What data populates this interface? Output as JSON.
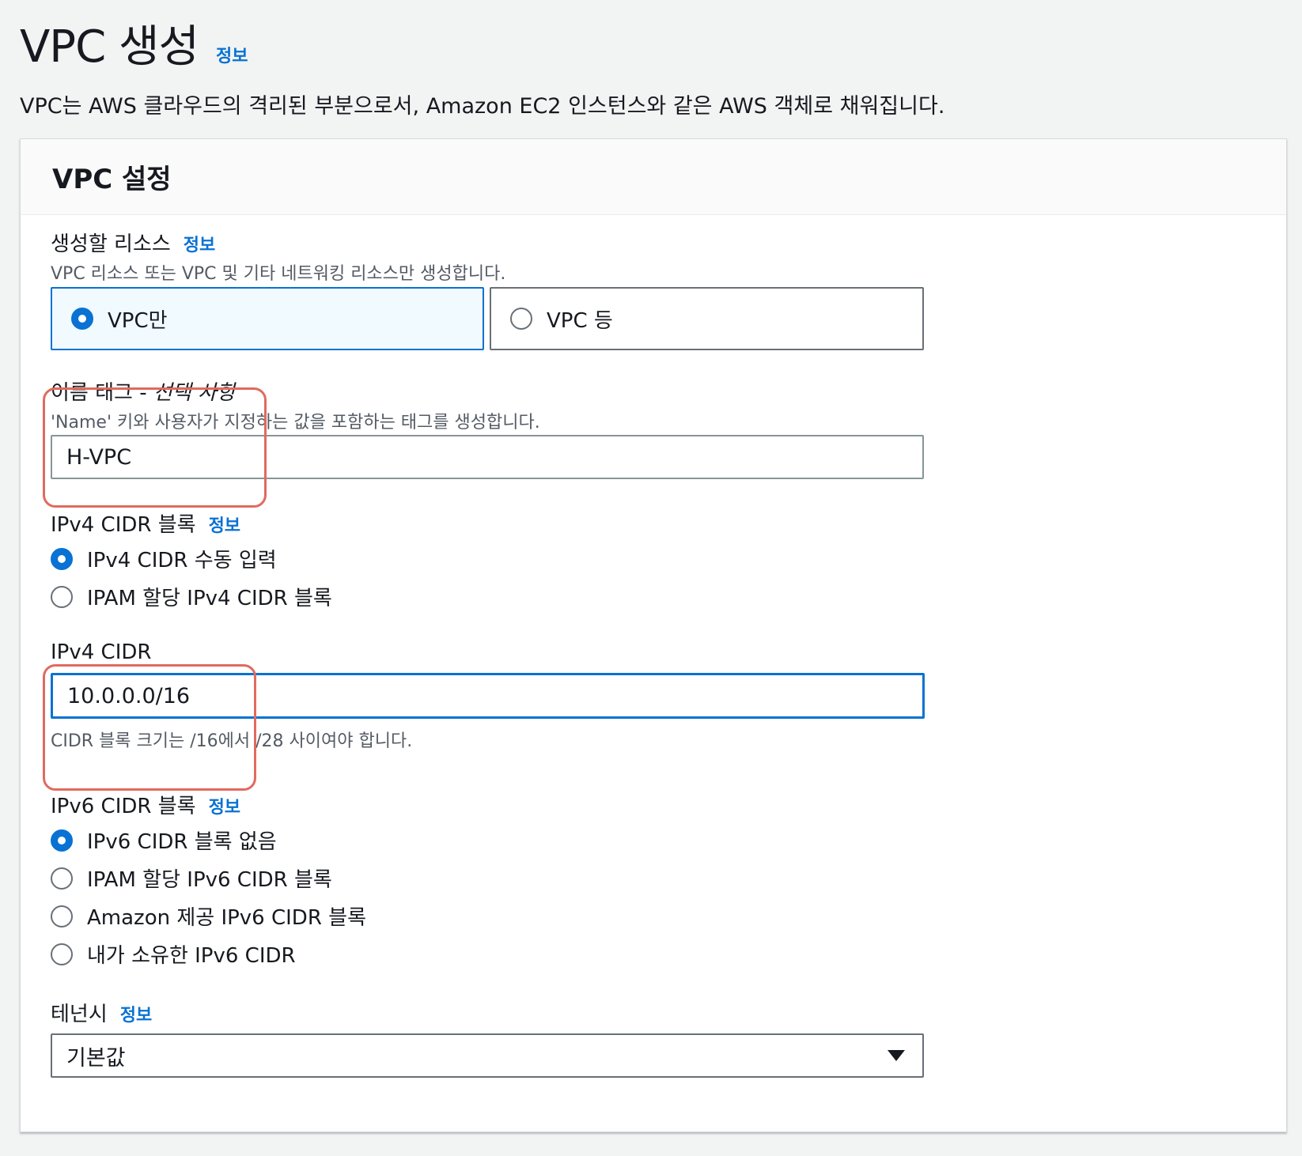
{
  "page": {
    "title": "VPC 생성",
    "info_link": "정보",
    "description": "VPC는 AWS 클라우드의 격리된 부분으로서, Amazon EC2 인스턴스와 같은 AWS 객체로 채워집니다."
  },
  "panel": {
    "title": "VPC 설정"
  },
  "resources": {
    "label": "생성할 리소스",
    "info_link": "정보",
    "description": "VPC 리소스 또는 VPC 및 기타 네트워킹 리소스만 생성합니다.",
    "options": [
      {
        "label": "VPC만",
        "selected": true
      },
      {
        "label": "VPC 등",
        "selected": false
      }
    ]
  },
  "name_tag": {
    "label": "이름 태그 - ",
    "label_optional": "선택 사항",
    "description": "'Name' 키와 사용자가 지정하는 값을 포함하는 태그를 생성합니다.",
    "value": "H-VPC"
  },
  "ipv4_block": {
    "label": "IPv4 CIDR 블록",
    "info_link": "정보",
    "options": [
      {
        "label": "IPv4 CIDR 수동 입력",
        "selected": true
      },
      {
        "label": "IPAM 할당 IPv4 CIDR 블록",
        "selected": false
      }
    ]
  },
  "ipv4_cidr": {
    "label": "IPv4 CIDR",
    "value": "10.0.0.0/16",
    "constraint": "CIDR 블록 크기는 /16에서 /28 사이여야 합니다."
  },
  "ipv6_block": {
    "label": "IPv6 CIDR 블록",
    "info_link": "정보",
    "options": [
      {
        "label": "IPv6 CIDR 블록 없음",
        "selected": true
      },
      {
        "label": "IPAM 할당 IPv6 CIDR 블록",
        "selected": false
      },
      {
        "label": "Amazon 제공 IPv6 CIDR 블록",
        "selected": false
      },
      {
        "label": "내가 소유한 IPv6 CIDR",
        "selected": false
      }
    ]
  },
  "tenancy": {
    "label": "테넌시",
    "info_link": "정보",
    "value": "기본값"
  },
  "colors": {
    "accent": "#0972d3",
    "callout": "#e06b5e",
    "background": "#f2f3f3"
  }
}
